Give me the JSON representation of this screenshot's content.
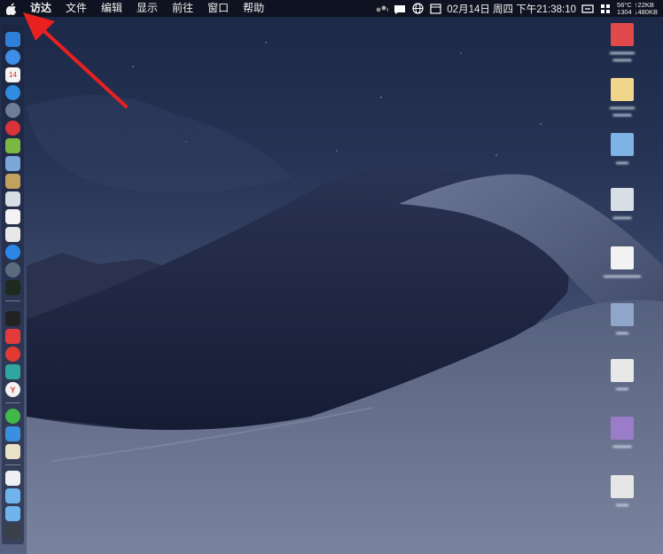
{
  "menubar": {
    "apple_icon": "apple-icon",
    "app_menu": "访达",
    "menus": [
      "文件",
      "编辑",
      "显示",
      "前往",
      "窗口",
      "帮助"
    ],
    "status": {
      "date_time": "02月14日 周四 下午21:38:10",
      "net_stats": {
        "temp": "56°C",
        "up": "↑22KB",
        "down_left": "1304",
        "down_right": "↓480KB"
      }
    }
  },
  "desktop_items": [
    {
      "label": "",
      "color": "#e04a4a"
    },
    {
      "label": "",
      "color": "#f0d68a"
    },
    {
      "label": "",
      "color": "#7fb3e6"
    },
    {
      "label": "",
      "color": "#d8dee6"
    },
    {
      "label": "",
      "color": "#f2f2f2"
    },
    {
      "label": "",
      "color": "#8fa6c8"
    },
    {
      "label": "",
      "color": "#e8e8e8"
    },
    {
      "label": "",
      "color": "#9b7cc8"
    },
    {
      "label": "",
      "color": "#e6e6e6"
    }
  ],
  "annotation": {
    "arrow_color": "#e82020"
  }
}
